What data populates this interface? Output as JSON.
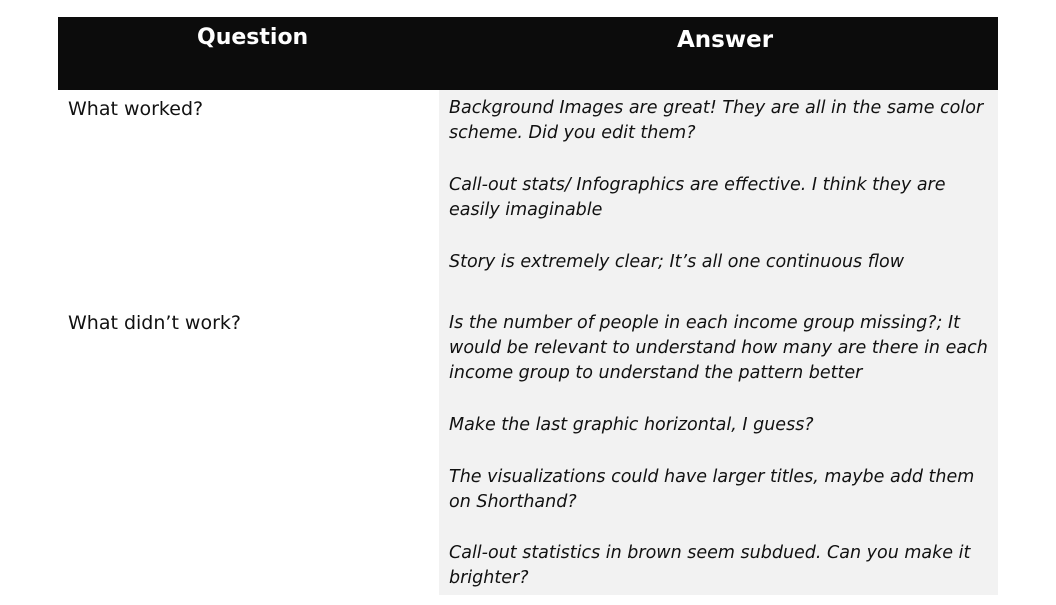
{
  "header": {
    "question": "Question",
    "answer": "Answer"
  },
  "rows": [
    {
      "question": "What worked?",
      "answers": [
        "Background Images are great! They are all in the same color scheme. Did you edit them?",
        "Call-out stats/ Infographics are effective.  I think they are easily imaginable",
        "Story is extremely clear; It’s all one continuous flow"
      ]
    },
    {
      "question": "What didn’t work?",
      "answers": [
        "Is the number of people in each income group missing?; It would be relevant to understand how many are there in each income group to understand the pattern better",
        "Make the last graphic horizontal, I guess?",
        "The visualizations could have larger titles, maybe add them on Shorthand?",
        "Call-out statistics in brown seem subdued. Can you make it brighter?"
      ]
    }
  ]
}
